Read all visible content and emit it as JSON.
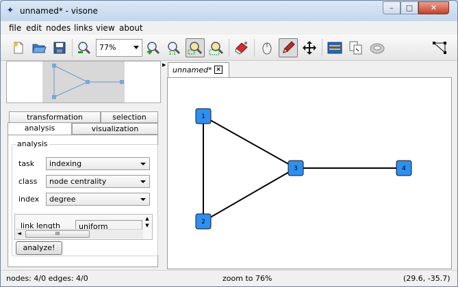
{
  "window": {
    "title": "unnamed* - visone",
    "controls": {
      "minimize": "–",
      "maximize": "□",
      "close": "✕"
    }
  },
  "menu": [
    "file",
    "edit",
    "nodes",
    "links",
    "view",
    "about"
  ],
  "toolbar": {
    "zoom_value": "77%",
    "icons": [
      "new-document",
      "open-folder",
      "save-disk",
      "zoom-out",
      "zoom-in",
      "zoom-fit",
      "zoom-selection",
      "zoom-fit-all",
      "eraser",
      "mouse-select",
      "pencil-draw",
      "move-arrows",
      "layout-panel",
      "copy-nodes",
      "network-view",
      "network-triangle"
    ]
  },
  "left_tabs": {
    "row1": [
      "transformation",
      "selection"
    ],
    "row2": [
      "analysis",
      "visualization"
    ],
    "selected": "analysis"
  },
  "analysis": {
    "group_title": "analysis",
    "task_label": "task",
    "task_value": "indexing",
    "class_label": "class",
    "class_value": "node centrality",
    "index_label": "index",
    "index_value": "degree",
    "link_length_label": "link length",
    "link_length_value": "uniform",
    "scroll_thumb": "III",
    "analyze_button": "analyze!"
  },
  "document_tab": {
    "title": "unnamed*",
    "close": "×"
  },
  "graph": {
    "node_color": "#2e8fef",
    "node_border": "#1a1a1a",
    "edge_color": "#000000",
    "nodes": [
      {
        "id": "1",
        "label": "1"
      },
      {
        "id": "2",
        "label": "2"
      },
      {
        "id": "3",
        "label": "3"
      },
      {
        "id": "4",
        "label": "4"
      }
    ],
    "edges": [
      [
        "1",
        "2"
      ],
      [
        "1",
        "3"
      ],
      [
        "2",
        "3"
      ],
      [
        "3",
        "4"
      ]
    ]
  },
  "status": {
    "counts": "nodes: 4/0  edges: 4/0",
    "zoom": "zoom to 76%",
    "coords": "(29.6, -35.7)"
  }
}
